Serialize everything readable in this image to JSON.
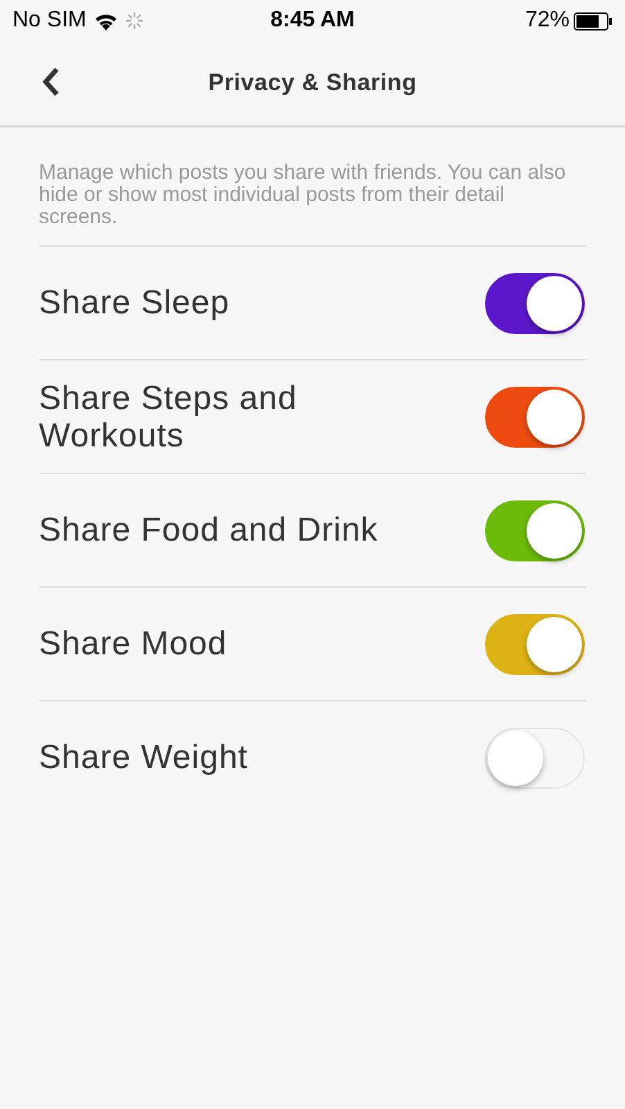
{
  "status_bar": {
    "carrier": "No SIM",
    "time": "8:45 AM",
    "battery": "72%"
  },
  "nav": {
    "title": "Privacy & Sharing"
  },
  "description": "Manage which posts you share with friends. You can also hide or show most individual posts from their detail screens.",
  "settings": [
    {
      "label": "Share Sleep",
      "on": true,
      "color": "#5b17c9"
    },
    {
      "label": "Share Steps and Workouts",
      "on": true,
      "color": "#ee4b10"
    },
    {
      "label": "Share Food and Drink",
      "on": true,
      "color": "#6cbb0a"
    },
    {
      "label": "Share Mood",
      "on": true,
      "color": "#deb315"
    },
    {
      "label": "Share Weight",
      "on": false
    }
  ]
}
